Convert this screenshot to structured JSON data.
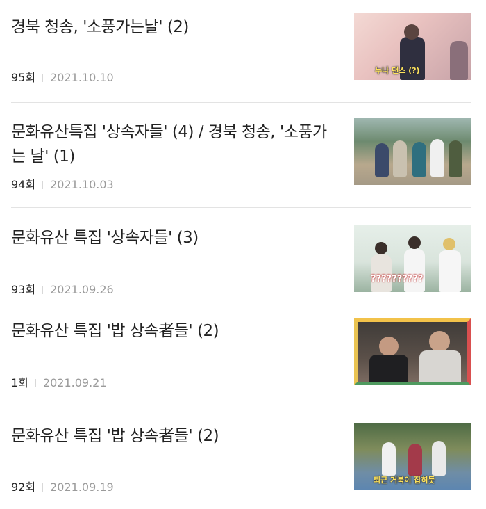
{
  "episodes": [
    {
      "title": "경북 청송, '소풍가는날' (2)",
      "episode": "95회",
      "date": "2021.10.10",
      "thumbnail_caption": "누나 댄스 (?)"
    },
    {
      "title": "문화유산특집 '상속자들' (4) / 경북 청송, '소풍가는 날' (1)",
      "episode": "94회",
      "date": "2021.10.03",
      "thumbnail_caption": ""
    },
    {
      "title": "문화유산 특집 '상속자들' (3)",
      "episode": "93회",
      "date": "2021.09.26",
      "thumbnail_caption": "??????????"
    },
    {
      "title": "문화유산 특집 '밥 상속者들' (2)",
      "episode": "1회",
      "date": "2021.09.21",
      "thumbnail_caption": ""
    },
    {
      "title": "문화유산 특집 '밥 상속者들' (2)",
      "episode": "92회",
      "date": "2021.09.19",
      "thumbnail_caption": "퇴근 거북이 잡히듯"
    }
  ]
}
